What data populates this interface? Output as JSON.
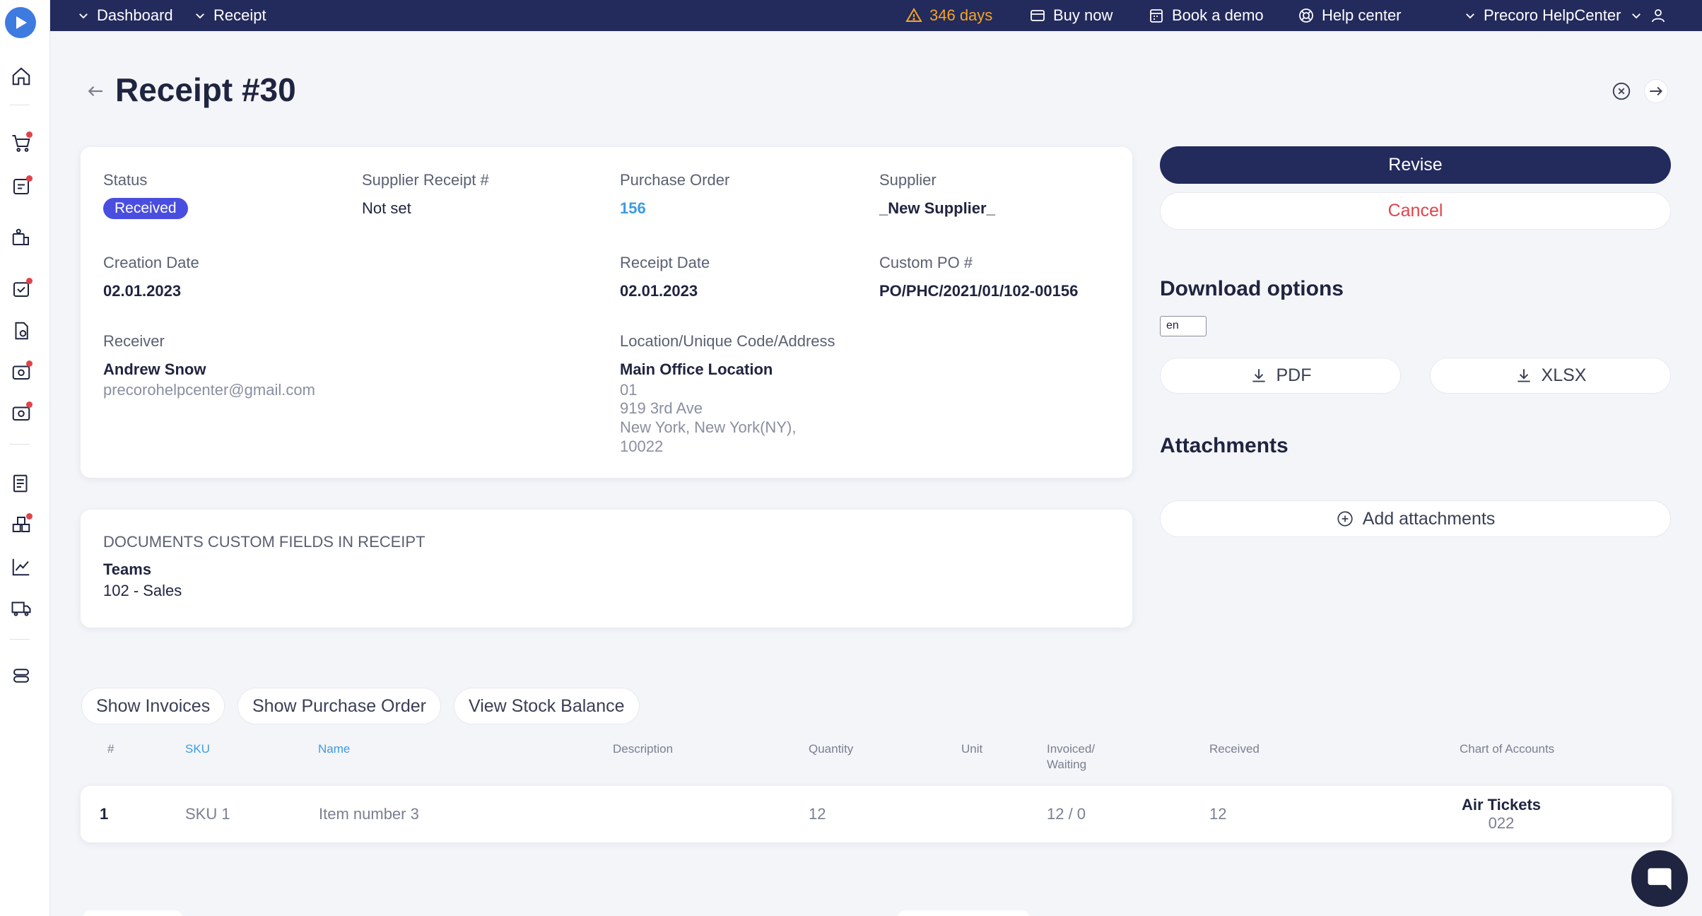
{
  "topbar": {
    "breadcrumb": [
      "Dashboard",
      "Receipt"
    ],
    "trial_days": "346 days",
    "buy_now": "Buy now",
    "book_demo": "Book a demo",
    "help_center": "Help center",
    "company": "Precoro HelpCenter"
  },
  "page": {
    "title": "Receipt #30"
  },
  "details": {
    "status_label": "Status",
    "status_value": "Received",
    "supplier_receipt_label": "Supplier Receipt #",
    "supplier_receipt_value": "Not set",
    "purchase_order_label": "Purchase Order",
    "purchase_order_value": "156",
    "supplier_label": "Supplier",
    "supplier_value": "_New Supplier_",
    "creation_date_label": "Creation Date",
    "creation_date_value": "02.01.2023",
    "receipt_date_label": "Receipt Date",
    "receipt_date_value": "02.01.2023",
    "custom_po_label": "Custom PO #",
    "custom_po_value": "PO/PHC/2021/01/102-00156",
    "receiver_label": "Receiver",
    "receiver_name": "Andrew Snow",
    "receiver_email": "precorohelpcenter@gmail.com",
    "location_label": "Location/Unique Code/Address",
    "location_name": "Main Office Location",
    "location_code": "01",
    "address_line1": "919 3rd Ave",
    "address_line2": "New York, New York(NY),",
    "address_line3": "10022"
  },
  "custom_fields": {
    "heading": "DOCUMENTS CUSTOM FIELDS IN RECEIPT",
    "field_label": "Teams",
    "field_value": "102 - Sales"
  },
  "actions": {
    "revise": "Revise",
    "cancel": "Cancel",
    "download_title": "Download options",
    "language": "en",
    "pdf": "PDF",
    "xlsx": "XLSX",
    "attachments_title": "Attachments",
    "add_attachments": "Add attachments"
  },
  "related_buttons": {
    "show_invoices": "Show Invoices",
    "show_purchase_order": "Show Purchase Order",
    "view_stock_balance": "View Stock Balance"
  },
  "table": {
    "headers": {
      "num": "#",
      "sku": "SKU",
      "name": "Name",
      "description": "Description",
      "quantity": "Quantity",
      "unit": "Unit",
      "invoiced_1": "Invoiced/",
      "invoiced_2": "Waiting",
      "received": "Received",
      "chart_of_accounts": "Chart of Accounts"
    },
    "rows": [
      {
        "num": "1",
        "sku": "SKU 1",
        "name": "Item number 3",
        "description": "",
        "quantity": "12",
        "unit": "",
        "invoiced": "12 / 0",
        "received": "12",
        "account_name": "Air Tickets",
        "account_code": "022"
      }
    ]
  },
  "colors": {
    "navy": "#232a5c",
    "accent_blue": "#3d9be0",
    "badge": "#4a4ee0",
    "danger": "#e2434b",
    "warning": "#f5a524"
  },
  "icons": {
    "sidebar": [
      "home-icon",
      "cart-icon",
      "requests-icon",
      "suppliers-icon",
      "approvals-icon",
      "invoices-icon",
      "receipts-icon",
      "payments-icon",
      "budgets-icon",
      "warehouse-icon",
      "analytics-icon",
      "delivery-icon",
      "settings-icon"
    ]
  }
}
